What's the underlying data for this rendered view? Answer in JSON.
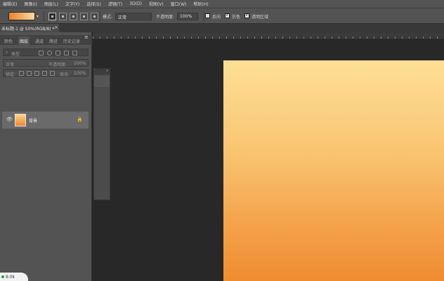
{
  "menu": [
    "编辑(E)",
    "图像(I)",
    "图层(L)",
    "文字(Y)",
    "选择(S)",
    "滤镜(T)",
    "3D(D)",
    "视图(V)",
    "窗口(W)",
    "帮助(H)"
  ],
  "options": {
    "mode_label": "模式:",
    "mode_value": "正常",
    "opacity_label": "不透明度:",
    "opacity_value": "100%",
    "reverse_label": "反向",
    "dither_label": "仿色",
    "transparency_label": "透明区域"
  },
  "document": {
    "tab_title": "未标题-1 @ 50%(RGB/8) *",
    "close_glyph": "×"
  },
  "layers_panel": {
    "tabs": [
      "颜色",
      "图层",
      "通道",
      "路径",
      "历史记录"
    ],
    "active_tab": "图层",
    "menu_glyph": "≡",
    "filter_kind": "类型",
    "blend_mode": "正常",
    "opacity_label": "不透明度:",
    "opacity_value": "100%",
    "lock_label": "锁定:",
    "fill_label": "填充:",
    "fill_value": "100%",
    "layers": [
      {
        "name": "背景",
        "visible": true,
        "locked": true
      }
    ]
  },
  "side_panel": {
    "collapse_glyph": "»"
  },
  "badge": {
    "text": "9.0k"
  },
  "colors": {
    "gradient_start": "#e8862a",
    "gradient_end": "#fbd99b",
    "canvas_top": "#fddf97",
    "canvas_bottom": "#ef8c30",
    "chrome": "#535353",
    "workspace": "#282828"
  }
}
